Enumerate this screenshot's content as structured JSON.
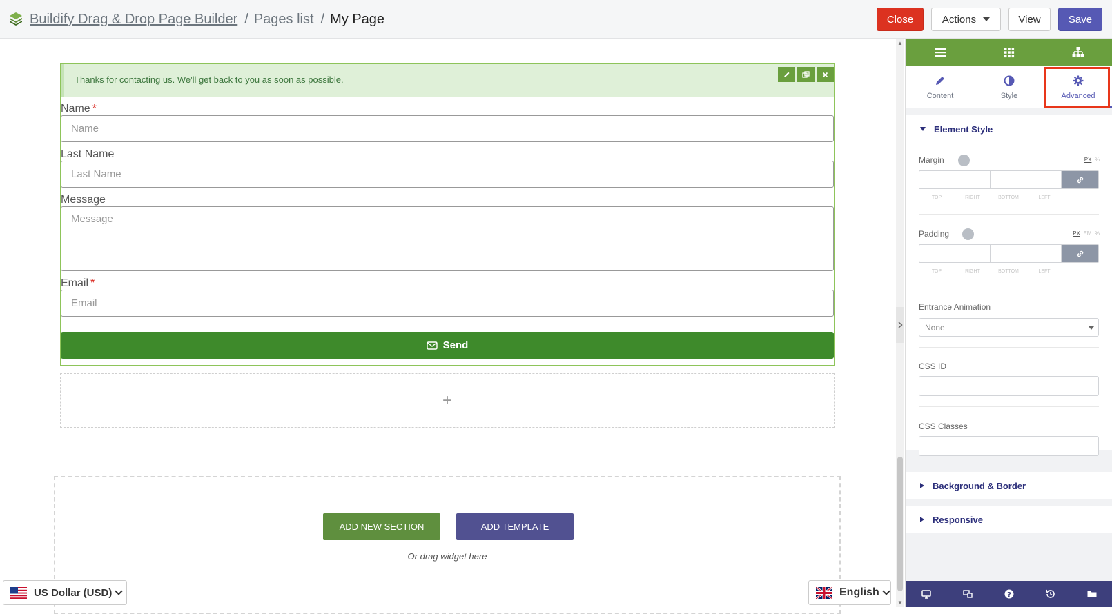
{
  "header": {
    "breadcrumb": {
      "app": "Buildify Drag & Drop Page Builder",
      "sep1": "/",
      "pages": "Pages list",
      "sep2": "/",
      "current": "My Page"
    },
    "buttons": {
      "close": "Close",
      "actions": "Actions",
      "view": "View",
      "save": "Save"
    }
  },
  "form": {
    "success_message": "Thanks for contacting us. We'll get back to you as soon as possible.",
    "required_mark": "*",
    "fields": {
      "name": {
        "label": "Name",
        "placeholder": "Name"
      },
      "last_name": {
        "label": "Last Name",
        "placeholder": "Last Name"
      },
      "message": {
        "label": "Message",
        "placeholder": "Message"
      },
      "email": {
        "label": "Email",
        "placeholder": "Email"
      }
    },
    "send_label": "Send"
  },
  "canvas": {
    "add_icon": "+",
    "add_section": "ADD NEW SECTION",
    "add_template": "ADD TEMPLATE",
    "drag_hint": "Or drag widget here"
  },
  "panel": {
    "tabs": {
      "content": "Content",
      "style": "Style",
      "advanced": "Advanced"
    },
    "active_tab": "advanced",
    "element_style": {
      "title": "Element Style",
      "margin": {
        "label": "Margin",
        "units": [
          "PX",
          "%"
        ]
      },
      "padding": {
        "label": "Padding",
        "units": [
          "PX",
          "EM",
          "%"
        ]
      },
      "dim_labels": [
        "TOP",
        "RIGHT",
        "BOTTOM",
        "LEFT"
      ],
      "entrance_animation": {
        "label": "Entrance Animation",
        "value": "None"
      },
      "css_id": {
        "label": "CSS ID"
      },
      "css_classes": {
        "label": "CSS Classes"
      }
    },
    "sections": {
      "background": "Background & Border",
      "responsive": "Responsive"
    }
  },
  "footer": {
    "currency": "US Dollar (USD)",
    "language": "English"
  },
  "colors": {
    "accent_green": "#6a9f3e",
    "send_green": "#3e8a2b",
    "accent_purple": "#5659b4",
    "danger": "#dc3220",
    "highlight": "#e8361a"
  },
  "icons": {
    "logo": "layers-icon",
    "panel_top": [
      "hamburger-icon",
      "grid-icon",
      "sitemap-icon"
    ],
    "tabs": [
      "pencil-icon",
      "contrast-icon",
      "gear-icon"
    ],
    "panel_bottom": [
      "desktop-icon",
      "responsive-icon",
      "help-icon",
      "history-icon",
      "folder-icon"
    ]
  }
}
